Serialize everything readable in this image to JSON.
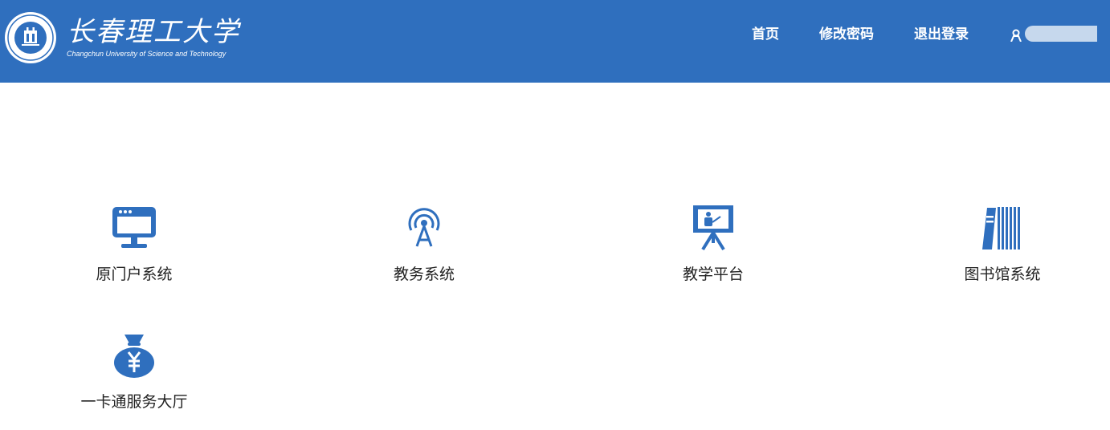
{
  "brand": {
    "name_cn": "长春理工大学",
    "name_en": "Changchun University of Science and Technology",
    "accent_color": "#2f6fbe"
  },
  "nav": {
    "home": "首页",
    "change_password": "修改密码",
    "logout": "退出登录",
    "user_icon": "user-icon"
  },
  "tiles": [
    {
      "label": "原门户系统",
      "icon": "monitor-icon"
    },
    {
      "label": "教务系统",
      "icon": "broadcast-tower-icon"
    },
    {
      "label": "教学平台",
      "icon": "presentation-board-icon"
    },
    {
      "label": "图书馆系统",
      "icon": "books-icon"
    },
    {
      "label": "一卡通服务大厅",
      "icon": "money-bag-icon"
    }
  ]
}
